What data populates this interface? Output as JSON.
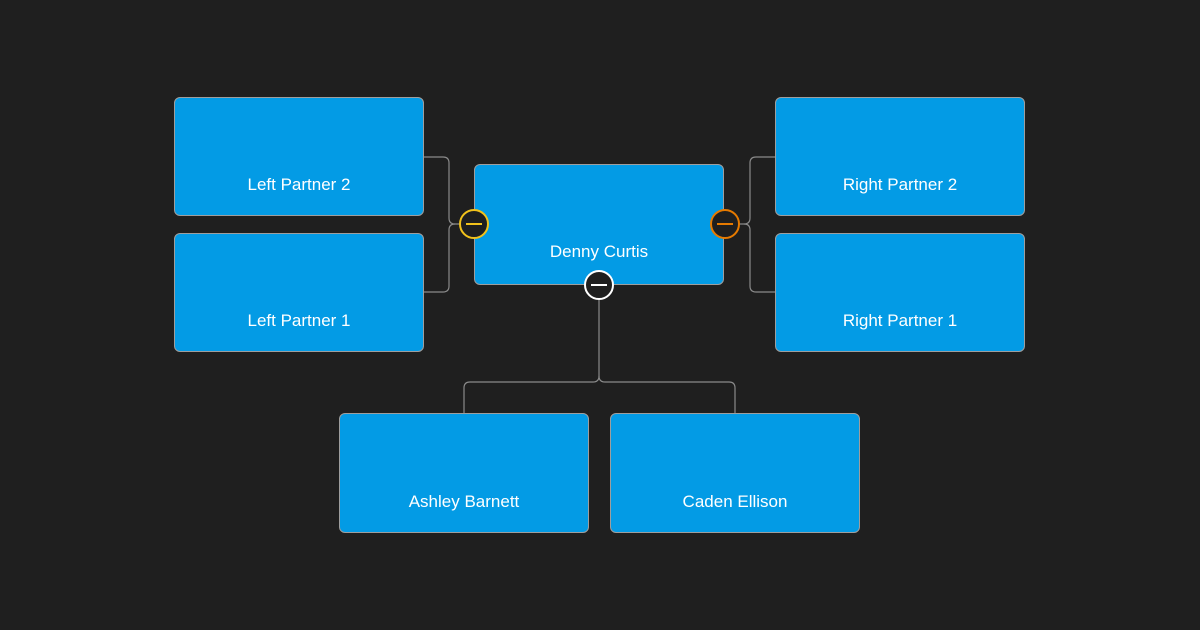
{
  "root": {
    "name": "Denny Curtis"
  },
  "left_partners": [
    {
      "name": "Left Partner 2"
    },
    {
      "name": "Left Partner 1"
    }
  ],
  "right_partners": [
    {
      "name": "Right Partner 2"
    },
    {
      "name": "Right Partner 1"
    }
  ],
  "children": [
    {
      "name": "Ashley Barnett"
    },
    {
      "name": "Caden Ellison"
    }
  ],
  "toggles": {
    "left": {
      "icon": "minus-icon",
      "color": "#f2c21b"
    },
    "right": {
      "icon": "minus-icon",
      "color": "#e67a00"
    },
    "children": {
      "icon": "minus-icon",
      "color": "#ffffff"
    }
  },
  "colors": {
    "background": "#1f1f1f",
    "node": "#039be5",
    "link": "#8a8a8a"
  }
}
